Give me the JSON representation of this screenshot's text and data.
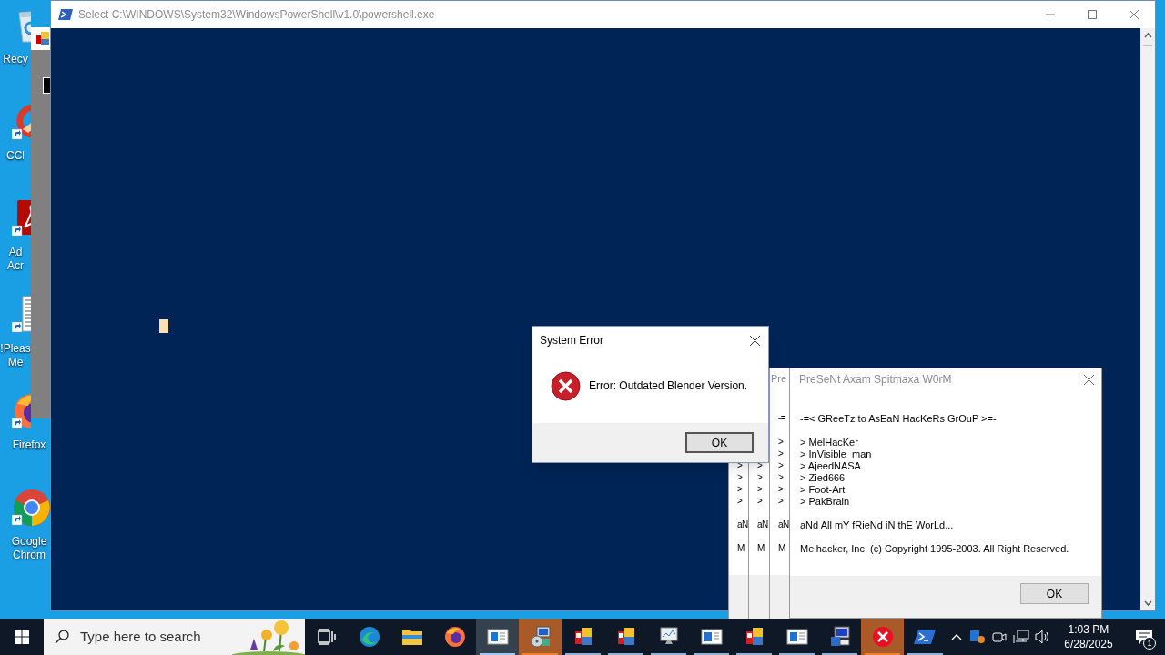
{
  "desktop_icons": [
    {
      "kind": "recycle-bin",
      "shortcut": false,
      "label": [
        "Recy"
      ]
    },
    {
      "kind": "cleaner",
      "shortcut": true,
      "label": [
        "CCl"
      ]
    },
    {
      "kind": "acrobat",
      "shortcut": true,
      "label": [
        "Ad",
        "Acr"
      ]
    },
    {
      "kind": "document",
      "shortcut": true,
      "label": [
        "!Pleas",
        "Me"
      ]
    },
    {
      "kind": "firefox",
      "shortcut": true,
      "label": [
        "Firefox"
      ]
    },
    {
      "kind": "chrome",
      "shortcut": true,
      "label": [
        "Google",
        "Chrom"
      ]
    }
  ],
  "console": {
    "title": "Select C:\\WINDOWS\\System32\\WindowsPowerShell\\v1.0\\powershell.exe"
  },
  "error_dialog": {
    "title": "System Error",
    "message": "Error: Outdated Blender Version.",
    "button": "OK"
  },
  "worm_dialogs_behind": [
    {
      "names": [
        ">",
        ">",
        ">",
        ">"
      ],
      "closing": "aN",
      "copyright": "M"
    },
    {
      "names": [
        ">",
        ">",
        ">",
        ">"
      ],
      "closing": "aN",
      "copyright": "M"
    },
    {
      "title": "Pre",
      "header": "-=",
      "names": [
        ">",
        ">",
        ">",
        ">",
        ">",
        ">"
      ],
      "closing": "aN",
      "copyright": "M"
    }
  ],
  "worm_dialog": {
    "title": "PreSeNt Axam Spitmaxa W0rM",
    "header": "-=< GReeTz to AsEaN HacKeRs GrOuP >=-",
    "names": [
      "> MelHacKer",
      "> InVisible_man",
      "> AjeedNASA",
      "> Zied666",
      "> Foot-Art",
      "> PakBrain"
    ],
    "closing": "aNd All mY fRieNd iN thE WorLd...",
    "copyright": "Melhacker, Inc. (c) Copyright 1995-2003. All Right Reserved.",
    "button": "OK"
  },
  "taskbar": {
    "search_placeholder": "Type here to search",
    "apps": [
      {
        "kind": "edge",
        "running": false,
        "active": false,
        "flashing": false
      },
      {
        "kind": "explorer",
        "running": false,
        "active": false,
        "flashing": false
      },
      {
        "kind": "firefox",
        "running": false,
        "active": false,
        "flashing": false
      },
      {
        "kind": "window",
        "running": true,
        "active": true,
        "flashing": false
      },
      {
        "kind": "setup",
        "running": true,
        "active": false,
        "flashing": true
      },
      {
        "kind": "tiles",
        "running": true,
        "active": false,
        "flashing": false
      },
      {
        "kind": "tiles",
        "running": true,
        "active": false,
        "flashing": false
      },
      {
        "kind": "monitor",
        "running": true,
        "active": false,
        "flashing": false
      },
      {
        "kind": "window",
        "running": true,
        "active": false,
        "flashing": false
      },
      {
        "kind": "tiles",
        "running": true,
        "active": false,
        "flashing": false
      },
      {
        "kind": "window",
        "running": true,
        "active": false,
        "flashing": false
      },
      {
        "kind": "computer",
        "running": true,
        "active": false,
        "flashing": false
      },
      {
        "kind": "error",
        "running": true,
        "active": false,
        "flashing": true
      },
      {
        "kind": "powershell",
        "running": true,
        "active": false,
        "flashing": false
      }
    ],
    "time": "1:03 PM",
    "date": "6/28/2025",
    "notification_count": "1"
  }
}
